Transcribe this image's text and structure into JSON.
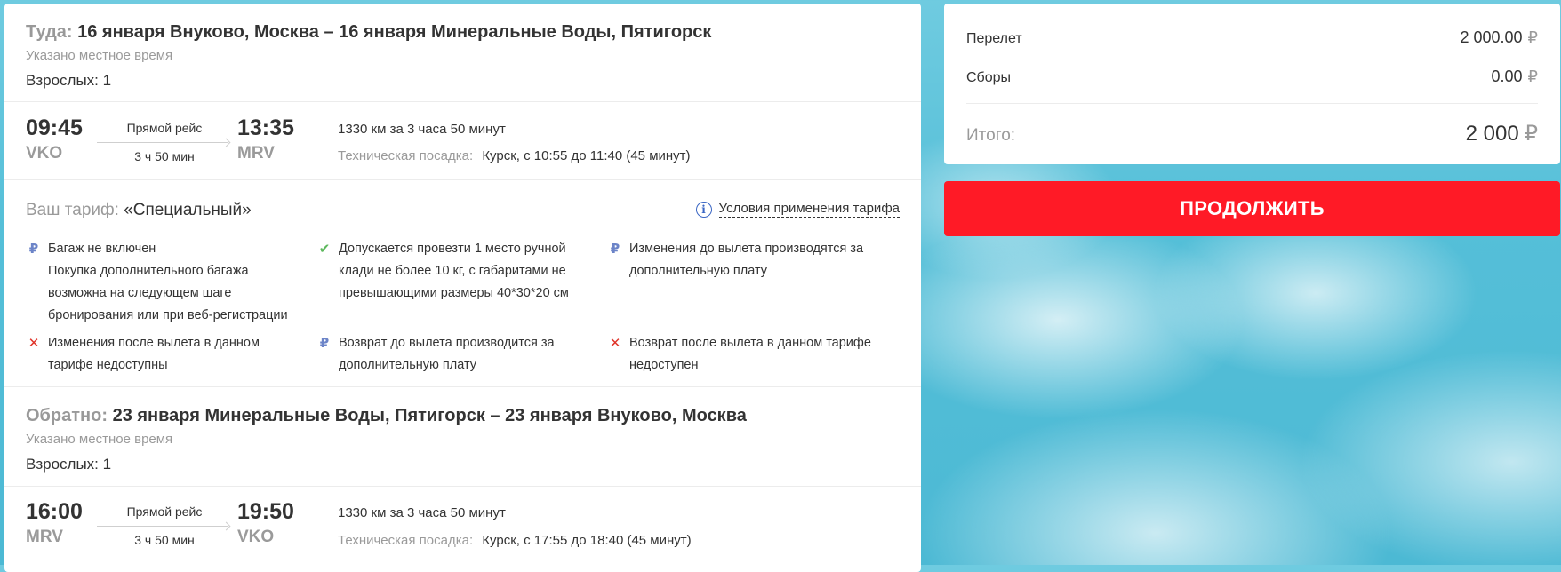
{
  "outbound": {
    "direction_label": "Туда:",
    "route": "16 января Внуково, Москва – 16 января Минеральные Воды, Пятигорск",
    "time_note": "Указано местное время",
    "passengers": "Взрослых: 1",
    "departure_time": "09:45",
    "departure_code": "VKO",
    "flight_type": "Прямой рейс",
    "duration": "3 ч 50 мин",
    "arrival_time": "13:35",
    "arrival_code": "MRV",
    "distance": "1330 км за 3 часа 50 минут",
    "stopover_label": "Техническая посадка:",
    "stopover_value": "Курск, с 10:55 до 11:40 (45 минут)"
  },
  "tariff": {
    "label": "Ваш тариф:",
    "name": "«Специальный»",
    "conditions_link": "Условия применения тарифа",
    "features": [
      {
        "icon": "ruble-icon",
        "text": "Багаж не включен\nПокупка дополнительного багажа возможна на следующем шаге бронирования или при веб-регистрации"
      },
      {
        "icon": "check-icon",
        "text": "Допускается провезти 1 место ручной клади не более 10 кг, с габаритами не превышающими размеры 40*30*20 см"
      },
      {
        "icon": "ruble-icon",
        "text": "Изменения до вылета производятся за дополнительную плату"
      },
      {
        "icon": "cross-icon",
        "text": "Изменения после вылета в данном тарифе недоступны"
      },
      {
        "icon": "ruble-icon",
        "text": "Возврат до вылета производится за дополнительную плату"
      },
      {
        "icon": "cross-icon",
        "text": "Возврат после вылета в данном тарифе недоступен"
      }
    ]
  },
  "inbound": {
    "direction_label": "Обратно:",
    "route": "23 января Минеральные Воды, Пятигорск – 23 января Внуково, Москва",
    "time_note": "Указано местное время",
    "passengers": "Взрослых: 1",
    "departure_time": "16:00",
    "departure_code": "MRV",
    "flight_type": "Прямой рейс",
    "duration": "3 ч 50 мин",
    "arrival_time": "19:50",
    "arrival_code": "VKO",
    "distance": "1330 км за 3 часа 50 минут",
    "stopover_label": "Техническая посадка:",
    "stopover_value": "Курск, с 17:55 до 18:40 (45 минут)"
  },
  "summary": {
    "flight_label": "Перелет",
    "flight_value": "2 000.00",
    "fees_label": "Сборы",
    "fees_value": "0.00",
    "total_label": "Итого:",
    "total_value": "2 000",
    "currency": "₽"
  },
  "actions": {
    "continue_label": "ПРОДОЛЖИТЬ"
  },
  "colors": {
    "accent_red": "#ff1a26",
    "info_blue": "#3a66c4",
    "background_sky": "#55bfd8"
  }
}
